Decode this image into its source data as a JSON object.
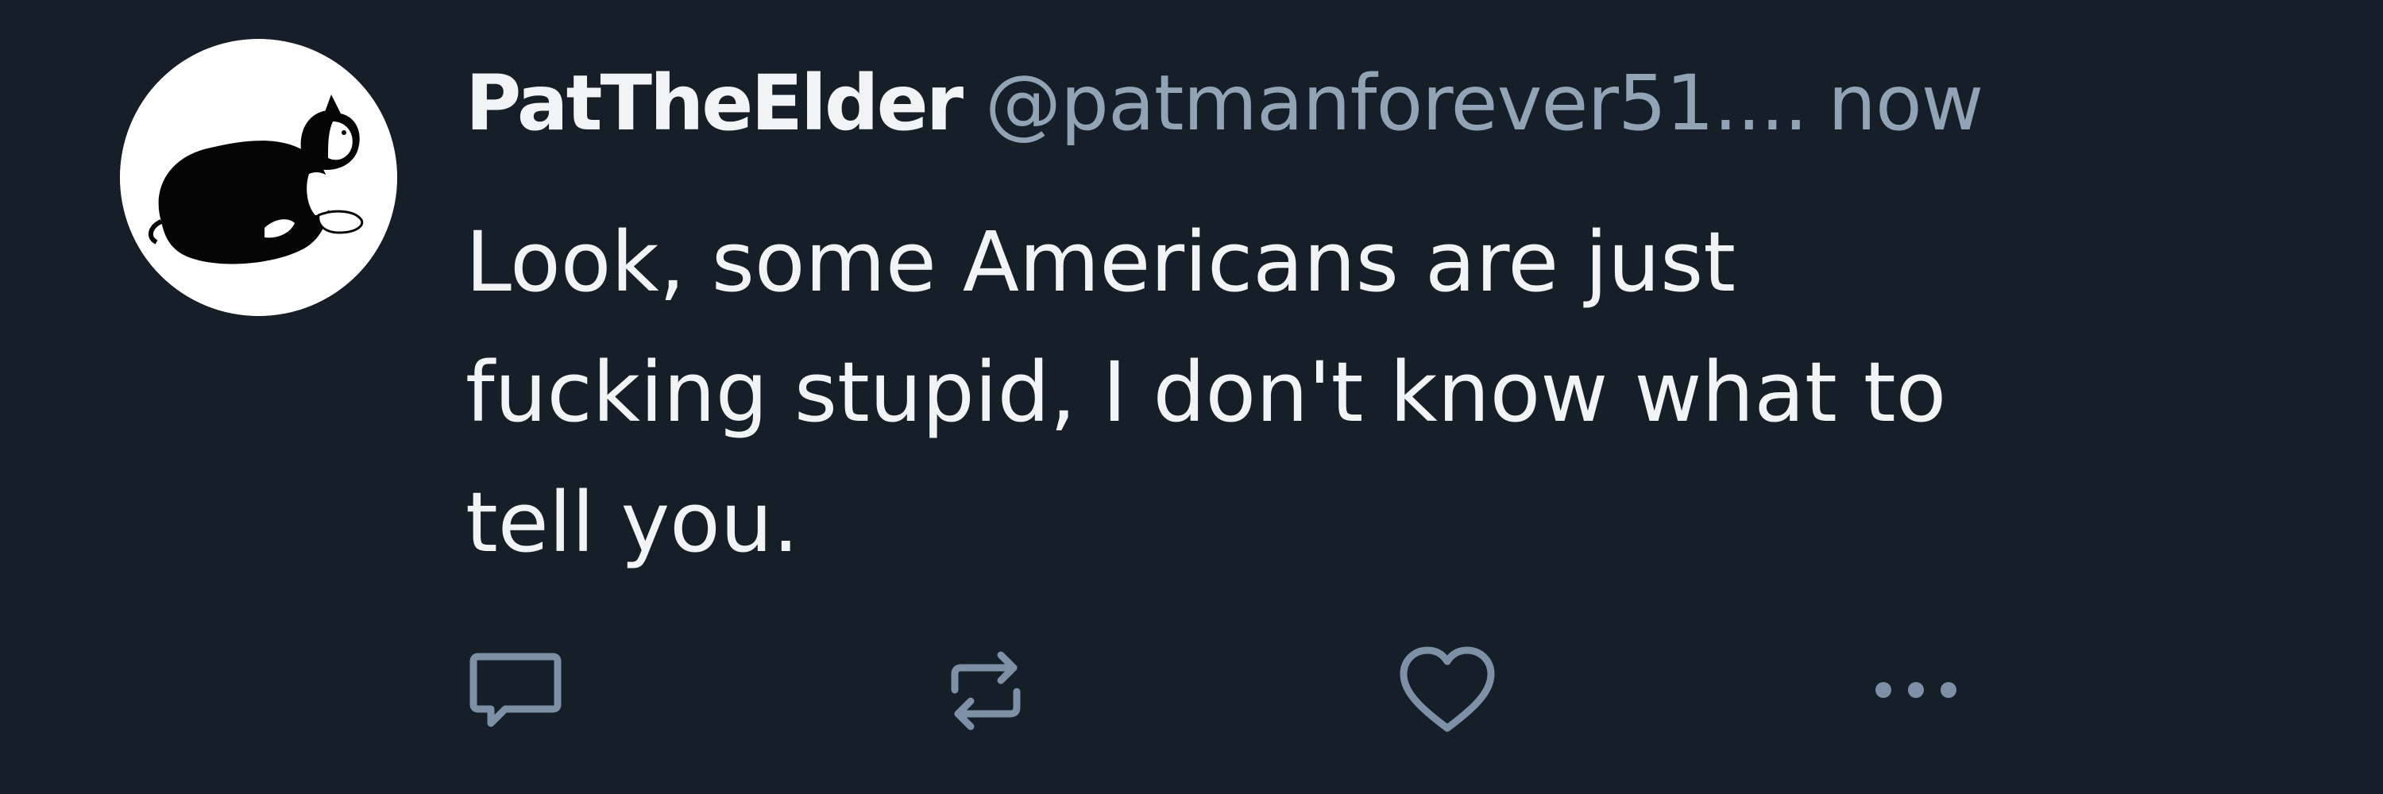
{
  "tweet": {
    "display_name": "PatTheElder",
    "handle": "@patmanforever51....",
    "timestamp": "now",
    "text_lines": [
      "Look, some Americans are just",
      "fucking stupid, I don't know what to",
      "tell you."
    ]
  },
  "avatar": {
    "description_icon": "black-and-white-cat-avatar"
  },
  "actions": {
    "reply_icon": "reply-icon",
    "retweet_icon": "retweet-icon",
    "like_icon": "heart-icon",
    "more_icon": "more-icon"
  },
  "colors": {
    "background": "#161e28",
    "primary_text": "#f1f3f5",
    "secondary_text": "#93a3b6",
    "icon": "#7e90a6"
  }
}
